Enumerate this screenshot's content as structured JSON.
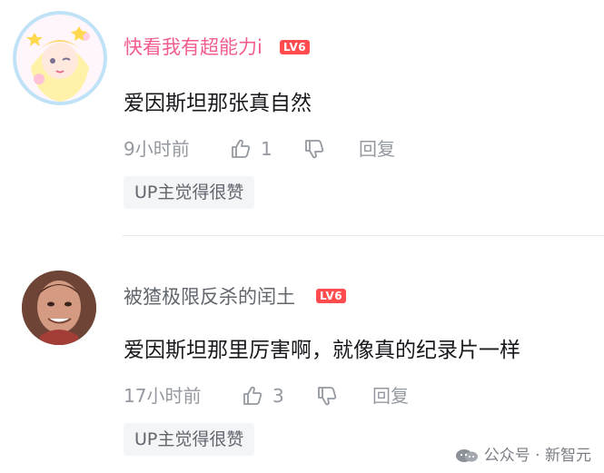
{
  "comments": [
    {
      "username": "快看我有超能力i",
      "level": "LV6",
      "content": "爱因斯坦那张真自然",
      "time": "9小时前",
      "likes": "1",
      "reply_label": "回复",
      "badge": "UP主觉得很赞",
      "name_color": "#f25d8e"
    },
    {
      "username": "被猹极限反杀的闰土",
      "level": "LV6",
      "content": "爱因斯坦那里厉害啊，就像真的纪录片一样",
      "time": "17小时前",
      "likes": "3",
      "reply_label": "回复",
      "badge": "UP主觉得很赞",
      "name_color": "#61666d"
    }
  ],
  "watermark": {
    "text": "公众号 · 新智元"
  },
  "icons": {
    "like": "thumbs-up-icon",
    "dislike": "thumbs-down-icon",
    "watermark": "wechat-icon"
  },
  "colors": {
    "level_badge": "#ff4d4f",
    "meta_text": "#9499a0",
    "content_text": "#18191c",
    "badge_bg": "#f4f5f7"
  }
}
